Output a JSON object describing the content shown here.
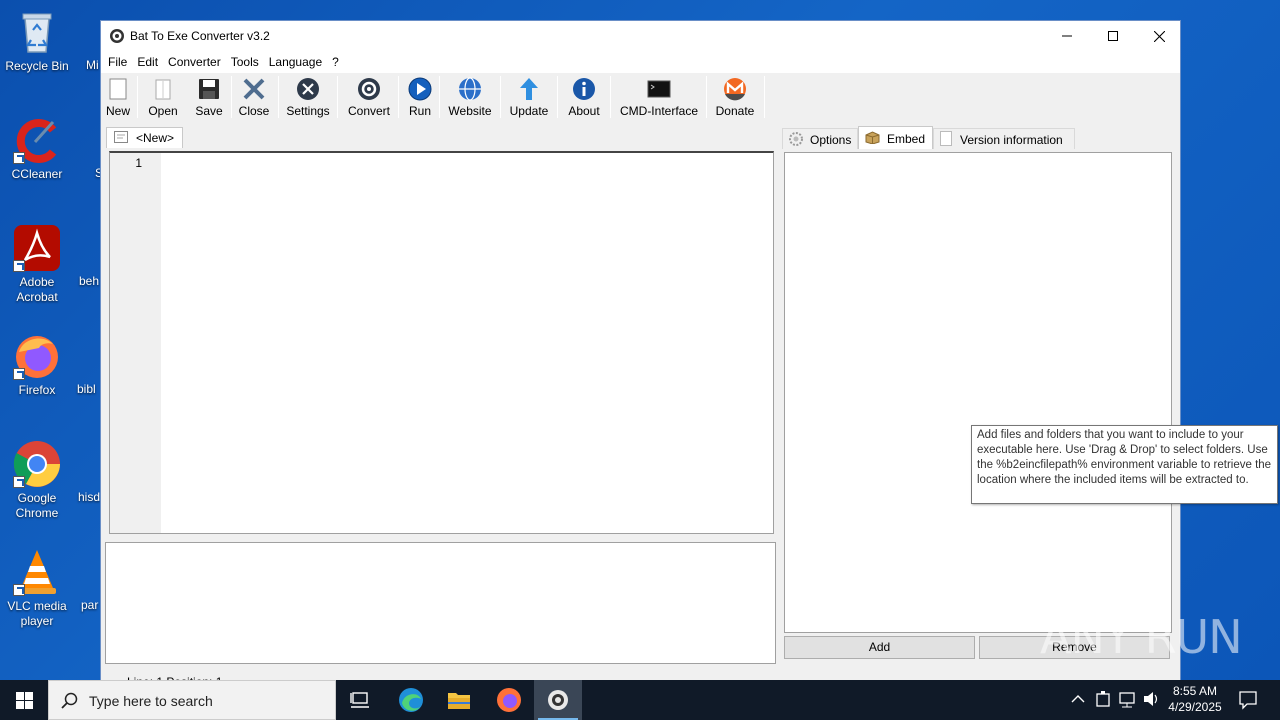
{
  "window": {
    "title": "Bat To Exe Converter v3.2"
  },
  "menu": [
    "File",
    "Edit",
    "Converter",
    "Tools",
    "Language",
    "?"
  ],
  "toolbar": {
    "new": "New",
    "open": "Open",
    "save": "Save",
    "close": "Close",
    "settings": "Settings",
    "convert": "Convert",
    "run": "Run",
    "website": "Website",
    "update": "Update",
    "about": "About",
    "cmd": "CMD-Interface",
    "donate": "Donate"
  },
  "editor": {
    "tab_label": "<New>",
    "line_number": "1"
  },
  "right_panel": {
    "tabs": [
      "Options",
      "Embed",
      "Version information"
    ],
    "active_tab": "Embed",
    "add_label": "Add",
    "remove_label": "Remove"
  },
  "tooltip": "Add files and folders that you want to include to your executable here. Use 'Drag & Drop' to select folders. Use the %b2eincfilepath% environment variable to retrieve the location where the included items will be extracted to.",
  "statusbar": "Line: 1  Position: 1",
  "desktop_icons": [
    "Recycle Bin",
    "CCleaner",
    "Adobe Acrobat",
    "Firefox",
    "Google Chrome",
    "VLC media player"
  ],
  "desktop_partial": [
    "Mi",
    "S",
    "beh",
    "bibl",
    "hisd",
    "par"
  ],
  "taskbar": {
    "search_placeholder": "Type here to search",
    "time": "8:55 AM",
    "date": "4/29/2025"
  },
  "watermark": "ANY RUN",
  "colors": {
    "desktop": "#0c56b8",
    "taskbar": "#101a28",
    "accent": "#76b9ed"
  }
}
